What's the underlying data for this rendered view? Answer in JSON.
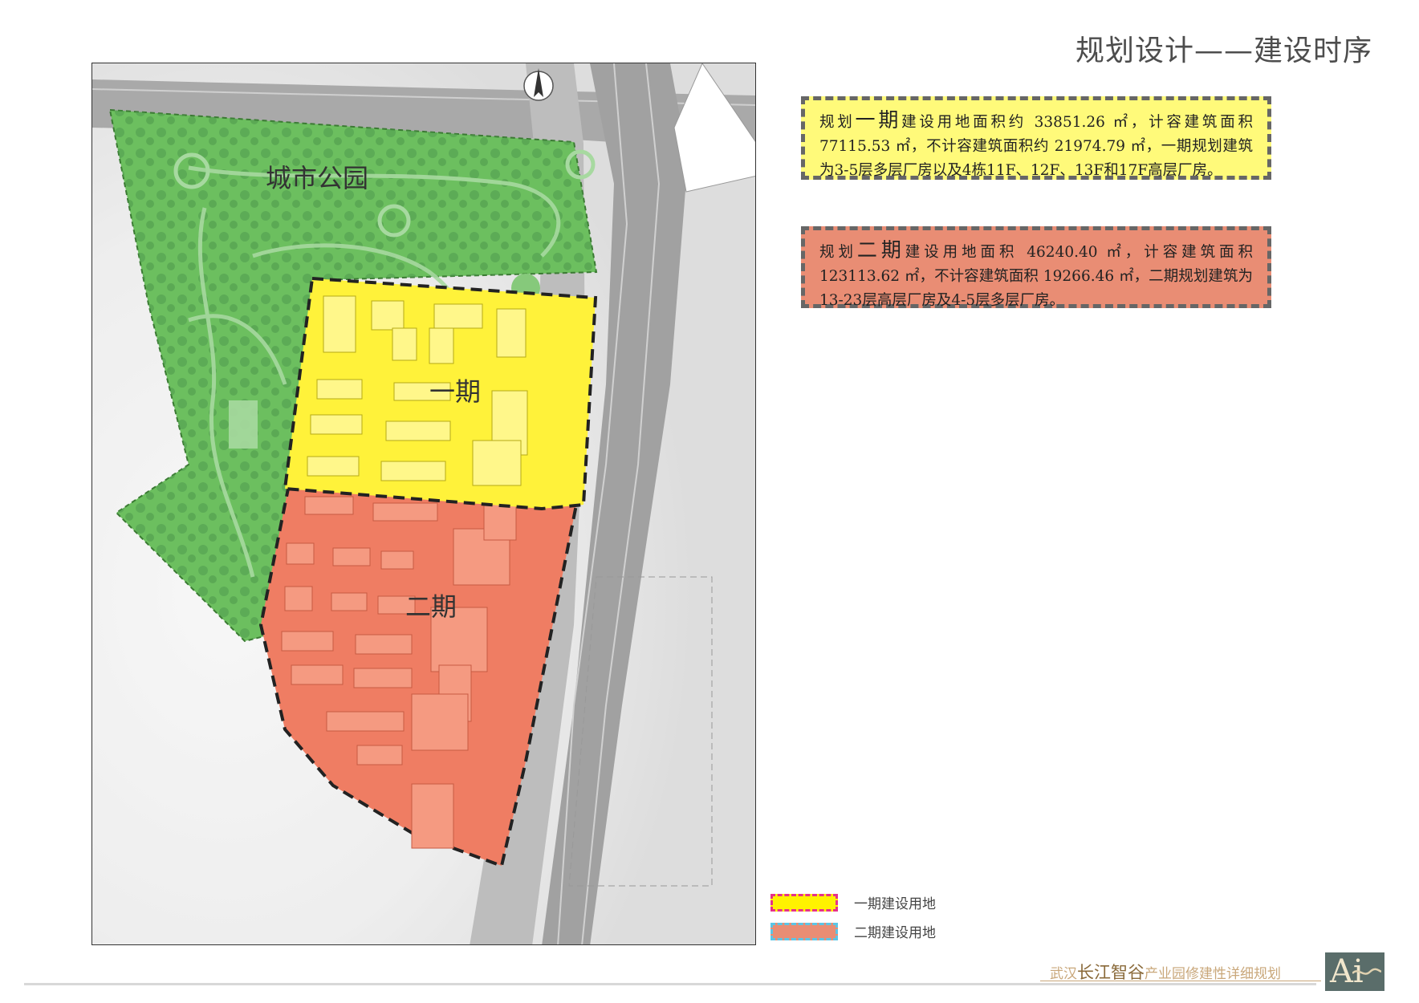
{
  "header": {
    "title": "规划设计——建设时序"
  },
  "map": {
    "labels": {
      "park": "城市公园",
      "phase1": "一期",
      "phase2": "二期"
    },
    "colors": {
      "park": "#5cb85c",
      "phase1": "#ffff3c",
      "phase2": "#ef7d63",
      "road": "#b4b4b4"
    },
    "north_arrow_icon": "north-arrow-icon"
  },
  "info": {
    "phase1": {
      "pre": "规划",
      "big": "一期",
      "text": "建设用地面积约 33851.26 ㎡，计容建筑面积 77115.53 ㎡，不计容建筑面积约 21974.79 ㎡，一期规划建筑为3-5层多层厂房以及4栋11F、12F、13F和17F高层厂房。",
      "bg": "#fffa7a"
    },
    "phase2": {
      "pre": "规划",
      "big": "二期",
      "text": "建设用地面积 46240.40 ㎡，计容建筑面积 123113.62 ㎡，不计容建筑面积 19266.46 ㎡，二期规划建筑为13-23层高层厂房及4-5层多层厂房。",
      "bg": "#e98d74"
    }
  },
  "legend": {
    "phase1": "一期建设用地",
    "phase2": "二期建设用地"
  },
  "footer": {
    "pre": "武汉",
    "em": "长江智谷",
    "post": "产业园修建性详细规划",
    "logo_text": "Ai"
  }
}
